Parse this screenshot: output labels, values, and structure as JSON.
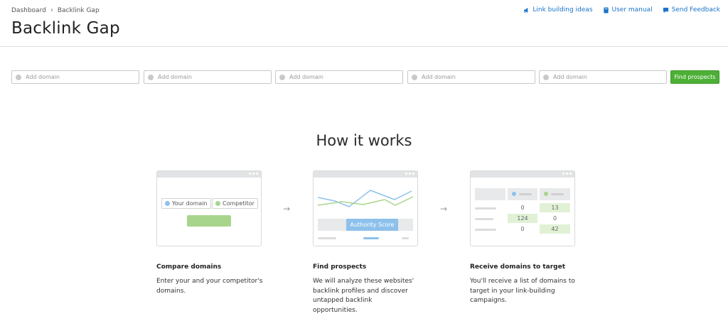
{
  "breadcrumb": {
    "items": [
      "Dashboard",
      "Backlink Gap"
    ]
  },
  "page_title": "Backlink Gap",
  "top_links": [
    {
      "label": "Link building ideas",
      "icon": "megaphone-icon"
    },
    {
      "label": "User manual",
      "icon": "book-icon"
    },
    {
      "label": "Send Feedback",
      "icon": "speech-bubble-icon"
    }
  ],
  "domain_inputs": [
    {
      "placeholder": "Add domain",
      "value": ""
    },
    {
      "placeholder": "Add domain",
      "value": ""
    },
    {
      "placeholder": "Add domain",
      "value": ""
    },
    {
      "placeholder": "Add domain",
      "value": ""
    },
    {
      "placeholder": "Add domain",
      "value": ""
    }
  ],
  "find_button": "Find prospects",
  "how_it_works": {
    "title": "How it works",
    "steps": [
      {
        "title": "Compare domains",
        "description": "Enter your and your competitor's domains.",
        "illustration": {
          "your_domain": "Your domain",
          "competitor": "Competitor"
        }
      },
      {
        "title": "Find prospects",
        "description": "We will analyze these websites' backlink profiles and discover untapped backlink opportunities.",
        "illustration": {
          "label": "Authority Score"
        }
      },
      {
        "title": "Receive domains to target",
        "description": "You'll receive a list of domains to target in your link-building campaigns.",
        "illustration": {
          "rows": [
            [
              "0",
              "13"
            ],
            [
              "124",
              "0"
            ],
            [
              "0",
              "42"
            ]
          ]
        }
      }
    ]
  },
  "colors": {
    "accent_green": "#4caf36",
    "link_blue": "#1a73c9",
    "your_domain_blue": "#8dc1ec",
    "competitor_green": "#a8d58c"
  }
}
